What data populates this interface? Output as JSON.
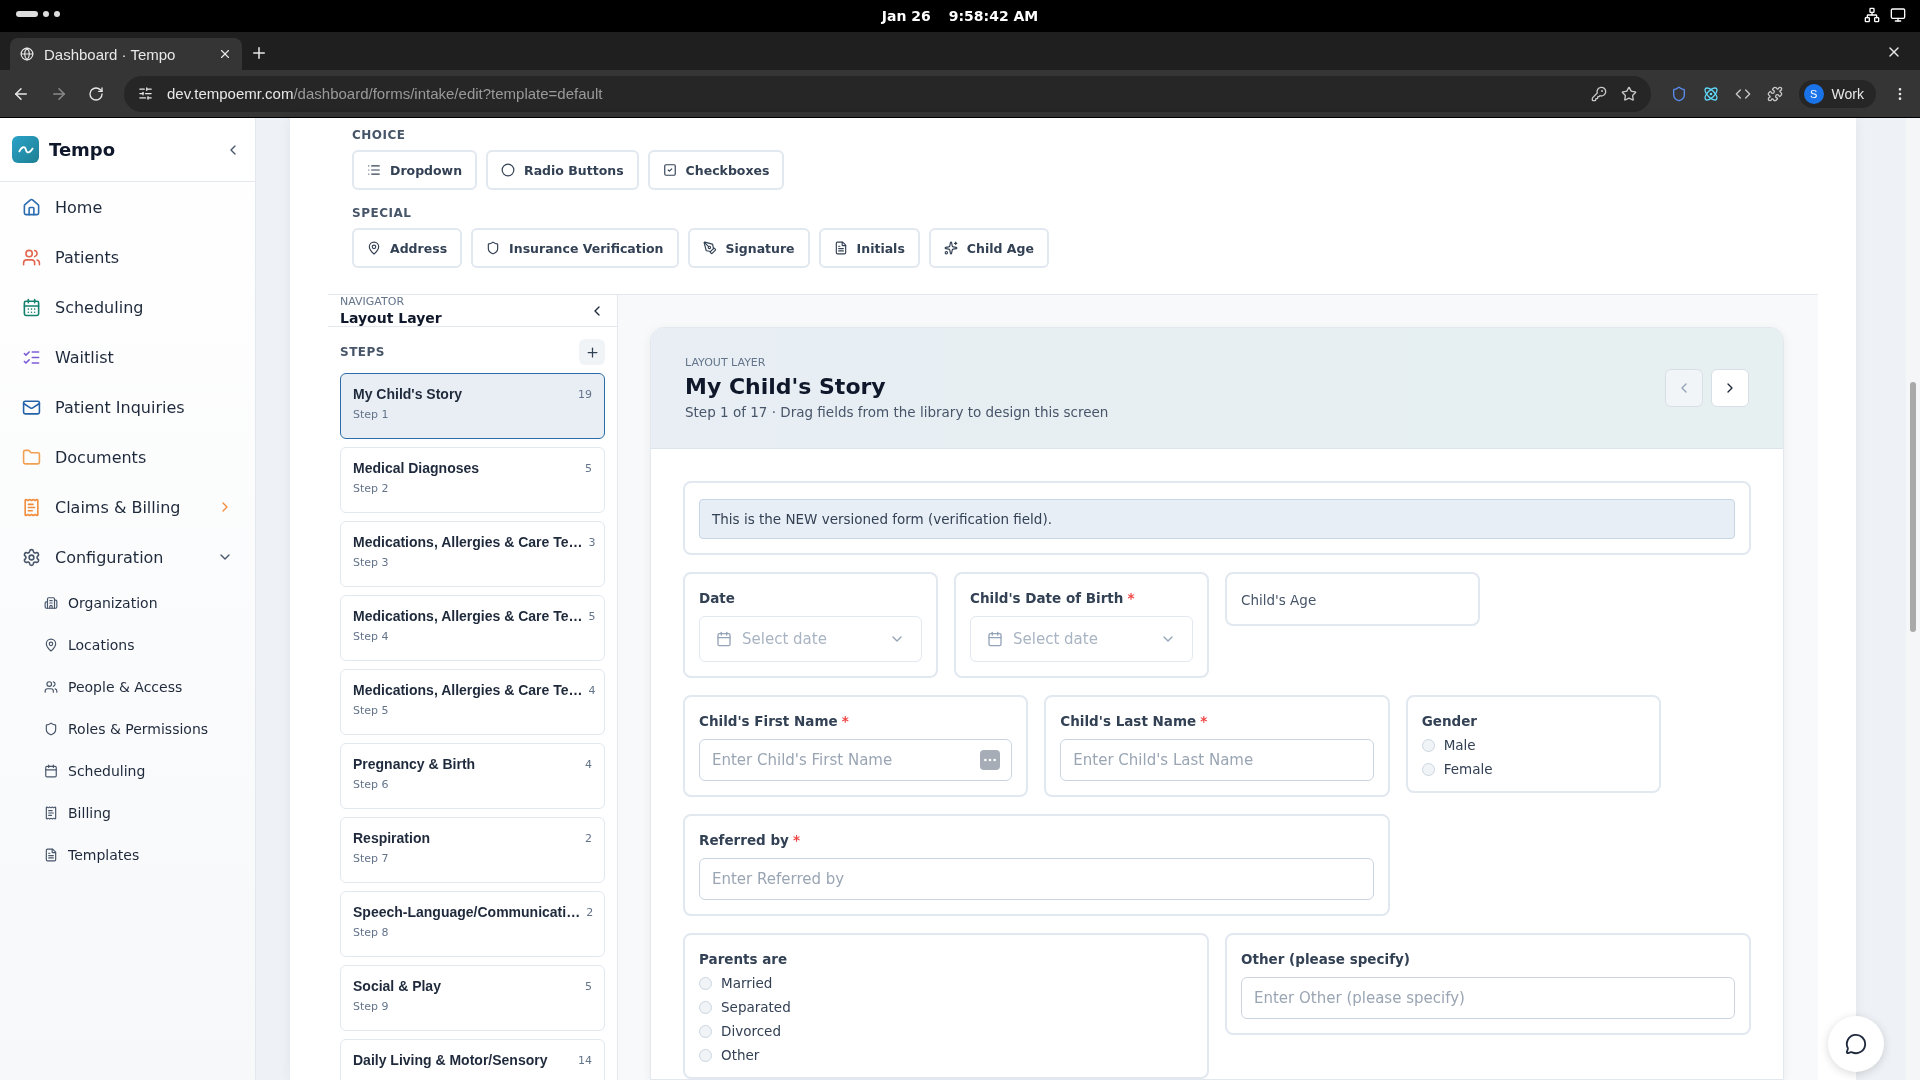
{
  "system_bar": {
    "date": "Jan 26",
    "time": "9:58:42 AM"
  },
  "browser": {
    "tab_title": "Dashboard · Tempo",
    "url_host": "dev.tempoemr.com",
    "url_path": "/dashboard/forms/intake/edit?template=default",
    "profile_initial": "S",
    "profile_name": "Work"
  },
  "sidebar": {
    "brand": "Tempo",
    "items": [
      {
        "kind": "link",
        "label": "Home"
      },
      {
        "kind": "link",
        "label": "Patients"
      },
      {
        "kind": "link",
        "label": "Scheduling"
      },
      {
        "kind": "link",
        "label": "Waitlist"
      },
      {
        "kind": "link",
        "label": "Patient Inquiries"
      },
      {
        "kind": "link",
        "label": "Documents"
      },
      {
        "kind": "group",
        "label": "Claims & Billing",
        "expanded": false
      },
      {
        "kind": "group",
        "label": "Configuration",
        "expanded": true,
        "children": [
          {
            "label": "Organization"
          },
          {
            "label": "Locations"
          },
          {
            "label": "People & Access"
          },
          {
            "label": "Roles & Permissions"
          },
          {
            "label": "Scheduling"
          },
          {
            "label": "Billing"
          },
          {
            "label": "Templates"
          }
        ]
      }
    ]
  },
  "palette": {
    "sections": [
      {
        "title": "CHOICE",
        "items": [
          "Dropdown",
          "Radio Buttons",
          "Checkboxes"
        ]
      },
      {
        "title": "SPECIAL",
        "items": [
          "Address",
          "Insurance Verification",
          "Signature",
          "Initials",
          "Child Age"
        ]
      }
    ]
  },
  "navigator": {
    "eyebrow": "NAVIGATOR",
    "title": "Layout Layer",
    "steps_heading": "STEPS",
    "steps": [
      {
        "title": "My Child's Story",
        "step": "Step 1",
        "count": "19",
        "selected": true
      },
      {
        "title": "Medical Diagnoses",
        "step": "Step 2",
        "count": "5",
        "selected": false
      },
      {
        "title": "Medications, Allergies & Care Te…",
        "step": "Step 3",
        "count": "3",
        "selected": false
      },
      {
        "title": "Medications, Allergies & Care Te…",
        "step": "Step 4",
        "count": "5",
        "selected": false
      },
      {
        "title": "Medications, Allergies & Care Te…",
        "step": "Step 5",
        "count": "4",
        "selected": false
      },
      {
        "title": "Pregnancy & Birth",
        "step": "Step 6",
        "count": "4",
        "selected": false
      },
      {
        "title": "Respiration",
        "step": "Step 7",
        "count": "2",
        "selected": false
      },
      {
        "title": "Speech-Language/Communicati…",
        "step": "Step 8",
        "count": "2",
        "selected": false
      },
      {
        "title": "Social & Play",
        "step": "Step 9",
        "count": "5",
        "selected": false
      },
      {
        "title": "Daily Living & Motor/Sensory",
        "count": "14",
        "selected": false
      }
    ]
  },
  "canvas": {
    "eyebrow": "LAYOUT LAYER",
    "title": "My Child's Story",
    "subtitle": "Step 1 of 17 · Drag fields from the library to design this screen",
    "rows": [
      [
        {
          "kind": "notice",
          "text": "This is the NEW versioned form (verification field)."
        }
      ],
      [
        {
          "kind": "date",
          "label": "Date",
          "placeholder": "Select date"
        },
        {
          "kind": "date",
          "label": "Child's Date of Birth",
          "required_mark": "*",
          "placeholder": "Select date"
        },
        {
          "kind": "label_only",
          "label": "Child's Age"
        }
      ],
      [
        {
          "kind": "text",
          "label": "Child's First Name",
          "required_mark": "*",
          "placeholder": "Enter Child's First Name",
          "has_autofill": true
        },
        {
          "kind": "text",
          "label": "Child's Last Name",
          "required_mark": "*",
          "placeholder": "Enter Child's Last Name"
        },
        {
          "kind": "radio",
          "label": "Gender",
          "options": [
            {
              "label": "Male",
              "selected": false
            },
            {
              "label": "Female",
              "selected": false
            }
          ]
        }
      ],
      [
        {
          "kind": "text",
          "label": "Referred by",
          "required_mark": "*",
          "placeholder": "Enter Referred by"
        }
      ],
      [
        {
          "kind": "radio",
          "label": "Parents are",
          "options": [
            {
              "label": "Married",
              "selected": false
            },
            {
              "label": "Separated",
              "selected": false
            },
            {
              "label": "Divorced",
              "selected": false
            },
            {
              "label": "Other",
              "selected": false
            }
          ]
        },
        {
          "kind": "text",
          "label": "Other (please specify)",
          "placeholder": "Enter Other (please specify)"
        }
      ]
    ]
  }
}
